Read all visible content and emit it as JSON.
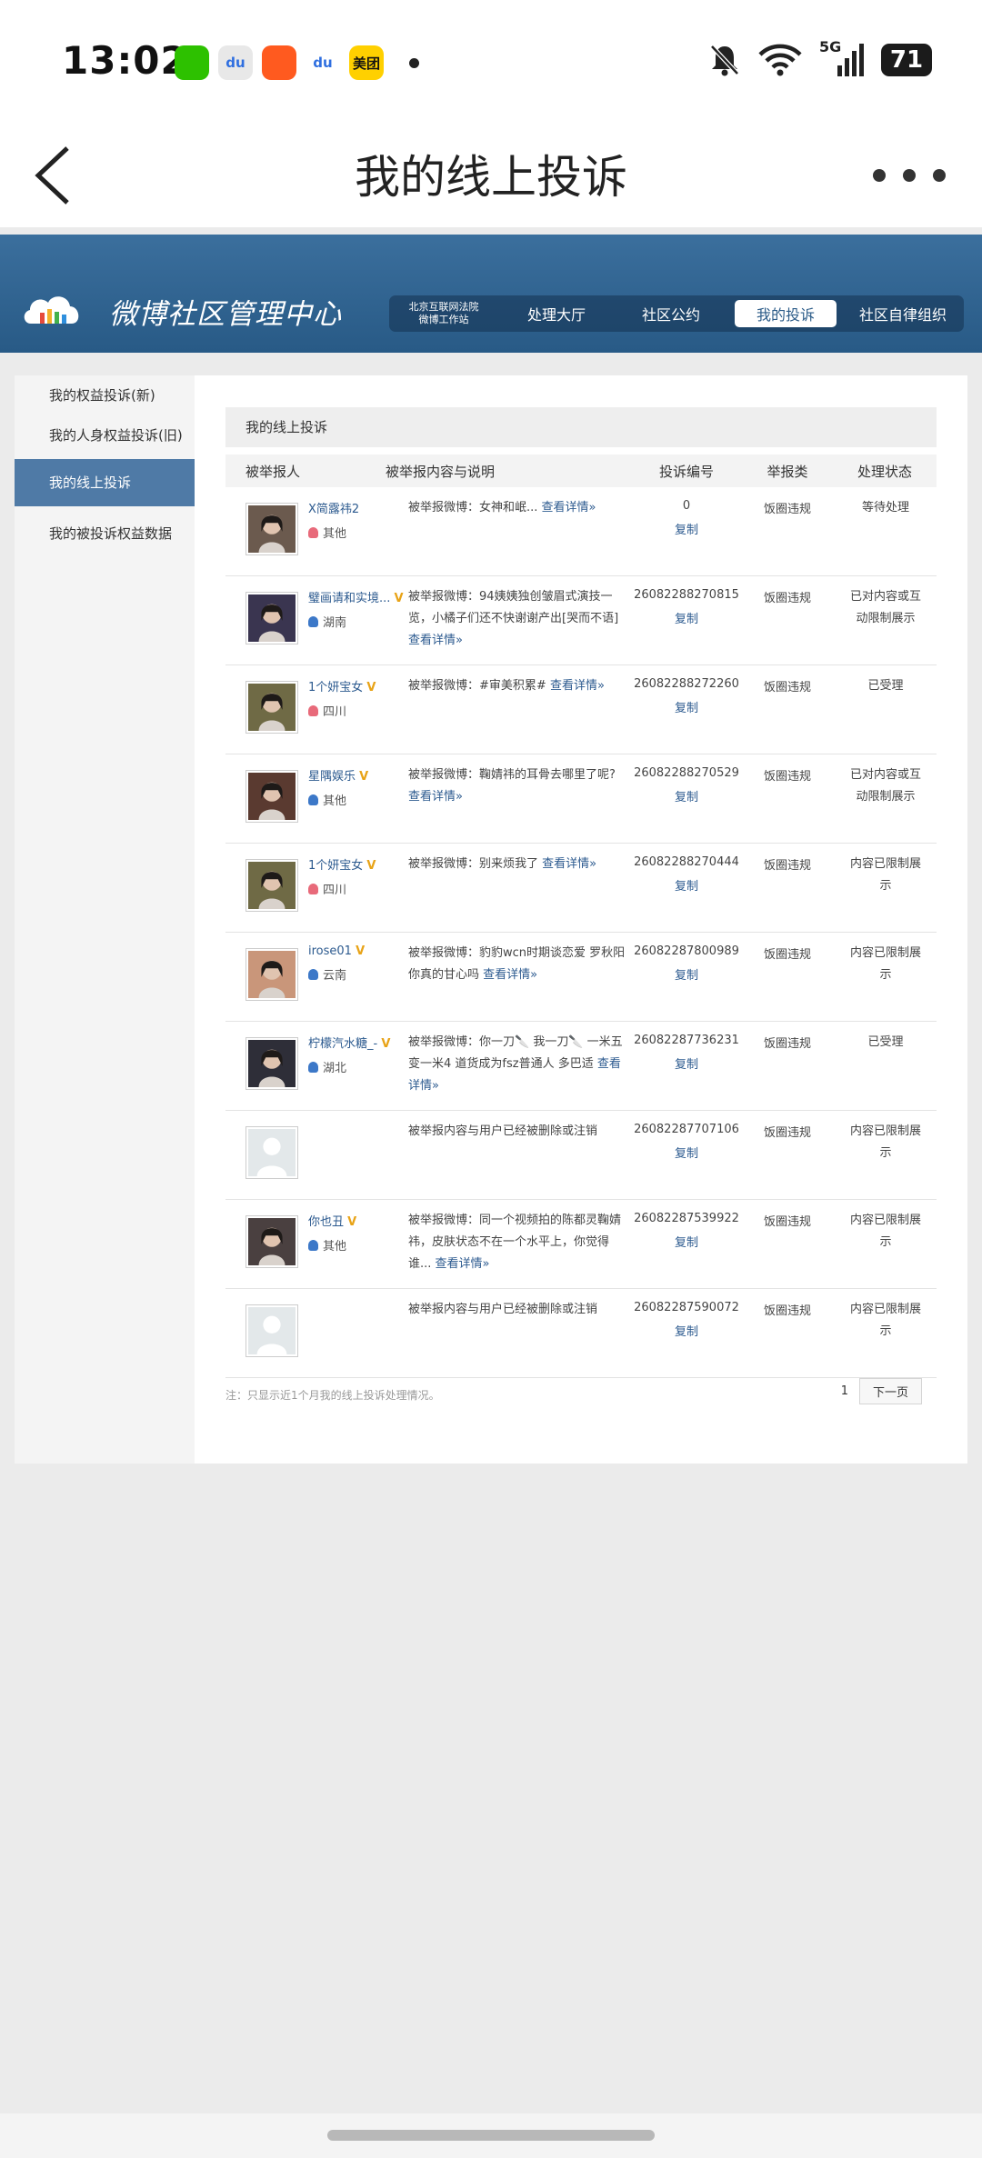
{
  "status_bar": {
    "time": "13:02",
    "apps": [
      {
        "name": "wechat-icon",
        "label": "",
        "color": "#2dc100"
      },
      {
        "name": "baidu-map-icon",
        "label": "du",
        "color": "#e8e8e8"
      },
      {
        "name": "kuaishou-icon",
        "label": "",
        "color": "#ff5a1f"
      },
      {
        "name": "baidu-icon",
        "label": "du",
        "color": "#ffffff"
      },
      {
        "name": "meituan-icon",
        "label": "美团",
        "color": "#ffd000"
      }
    ],
    "network": "5G",
    "battery": "71"
  },
  "nav": {
    "title": "我的线上投诉"
  },
  "weibo_header": {
    "title": "微博社区管理中心",
    "nav_first_line1": "北京互联网法院",
    "nav_first_line2": "微博工作站",
    "nav_items": [
      "处理大厅",
      "社区公约",
      "我的投诉",
      "社区自律组织"
    ]
  },
  "sidebar": {
    "items": [
      "我的权益投诉(新)",
      "我的人身权益投诉(旧)",
      "我的线上投诉",
      "我的被投诉权益数据"
    ]
  },
  "main": {
    "section_title": "我的线上投诉",
    "columns": [
      "被举报人",
      "被举报内容与说明",
      "投诉编号",
      "举报类",
      "处理状态"
    ],
    "copy_label": "复制",
    "detail_label": "查看详情»",
    "rows": [
      {
        "name": "X简露祎2",
        "verified": false,
        "loc": "其他",
        "gender": "f",
        "desc": "被举报微博：女神和岷...",
        "detail": true,
        "id": "0",
        "type": "饭圈违规",
        "status": "等待处理",
        "avatar": "#6b5a4e"
      },
      {
        "name": "璧画请和实境...",
        "verified": true,
        "loc": "湖南",
        "gender": "m",
        "desc": "被举报微博：94姨姨独创皱眉式演技一览，小橘子们还不快谢谢产出[哭而不语]",
        "detail": true,
        "id": "26082288270815",
        "type": "饭圈违规",
        "status": "已对内容或互动限制展示",
        "avatar": "#3a3550"
      },
      {
        "name": "1个妍宝女",
        "verified": true,
        "loc": "四川",
        "gender": "f",
        "desc": "被举报微博：#审美积累#",
        "detail": true,
        "id": "26082288272260",
        "type": "饭圈违规",
        "status": "已受理",
        "avatar": "#6f6a45"
      },
      {
        "name": "星隅娱乐",
        "verified": true,
        "loc": "其他",
        "gender": "m",
        "desc": "被举报微博：鞠婧祎的耳骨去哪里了呢?",
        "detail": true,
        "id": "26082288270529",
        "type": "饭圈违规",
        "status": "已对内容或互动限制展示",
        "avatar": "#5a3a30"
      },
      {
        "name": "1个妍宝女",
        "verified": true,
        "loc": "四川",
        "gender": "f",
        "desc": "被举报微博：别来烦我了",
        "detail": true,
        "id": "26082288270444",
        "type": "饭圈违规",
        "status": "内容已限制展示",
        "avatar": "#6f6a45"
      },
      {
        "name": "irose01",
        "verified": true,
        "loc": "云南",
        "gender": "m",
        "desc": "被举报微博：豹豹wcn时期谈恋爱 罗秋阳你真的甘心吗",
        "detail": true,
        "id": "26082287800989",
        "type": "饭圈违规",
        "status": "内容已限制展示",
        "avatar": "#c9967a"
      },
      {
        "name": "柠檬汽水糖_-",
        "verified": true,
        "loc": "湖北",
        "gender": "m",
        "desc": "被举报微博：你一刀🔪 我一刀🔪 一米五变一米4 道货成为fsz普通人 多巴适",
        "detail": true,
        "id": "26082287736231",
        "type": "饭圈违规",
        "status": "已受理",
        "avatar": "#2e2e38"
      },
      {
        "name": "",
        "verified": false,
        "loc": "",
        "gender": "",
        "desc": "被举报内容与用户已经被删除或注销",
        "detail": false,
        "id": "26082287707106",
        "type": "饭圈违规",
        "status": "内容已限制展示",
        "avatar": "#dfe4e6"
      },
      {
        "name": "你也丑",
        "verified": true,
        "loc": "其他",
        "gender": "m",
        "desc": "被举报微博：同一个视频拍的陈都灵鞠婧祎，皮肤状态不在一个水平上，你觉得谁...",
        "detail": true,
        "id": "26082287539922",
        "type": "饭圈违规",
        "status": "内容已限制展示",
        "avatar": "#4a4040"
      },
      {
        "name": "",
        "verified": false,
        "loc": "",
        "gender": "",
        "desc": "被举报内容与用户已经被删除或注销",
        "detail": false,
        "id": "26082287590072",
        "type": "饭圈违规",
        "status": "内容已限制展示",
        "avatar": "#dfe4e6"
      }
    ],
    "footer_note": "注：只显示近1个月我的线上投诉处理情况。",
    "page_number": "1",
    "next_label": "下一页"
  }
}
